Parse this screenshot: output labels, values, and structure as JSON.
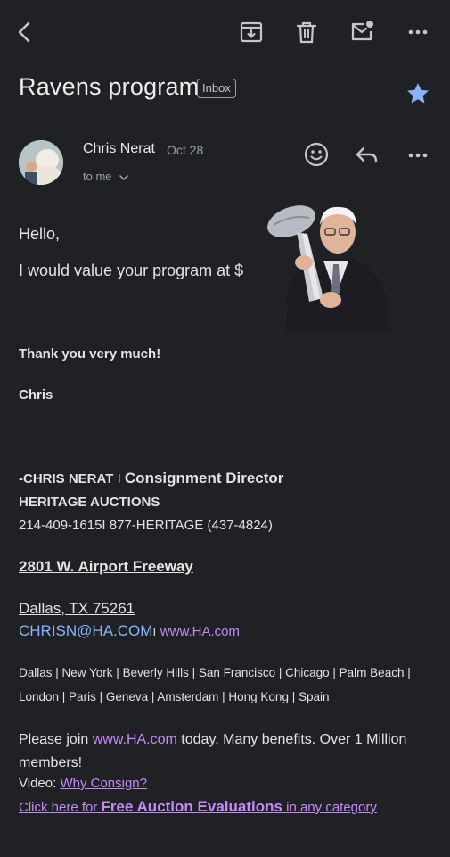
{
  "toolbar": {
    "back_icon": "back-arrow-icon",
    "archive_icon": "archive-icon",
    "delete_icon": "trash-icon",
    "mark_unread_icon": "mail-unread-icon",
    "more_icon": "more-icon"
  },
  "email": {
    "subject": "Ravens program",
    "label": "Inbox",
    "sender": "Chris Nerat",
    "date": "Oct 28",
    "recipient": "to me",
    "starred": true
  },
  "body": {
    "greeting": "Hello,",
    "line1": "I would value your program at $",
    "thanks": "Thank you very much!",
    "signoff": "Chris"
  },
  "signature": {
    "name_prefix": "-CHRIS NERAT",
    "divider": "I",
    "title": "Consignment Director",
    "company": "HERITAGE AUCTIONS",
    "phones": "214-409-1615I 877-HERITAGE (437-4824)",
    "street": "2801 W. Airport Freeway",
    "city": "Dallas, TX 75261",
    "email": "CHRISN@HA.COM",
    "email_sep": "I",
    "site": "www.HA.com",
    "locations_1": "Dallas | New York | Beverly Hills | San Francisco | Chicago | Palm Beach |",
    "locations_2": "London | Paris | Geneva | Amsterdam | Hong Kong | Spain",
    "join_prefix": "Please join",
    "join_link": " www.HA.com",
    "join_suffix": " today. Many benefits. Over 1 Million members!",
    "video_label": "Video: ",
    "video_link": "Why Consign? ",
    "click_here": "Click here for ",
    "free_eval": "Free Auction Evaluations",
    "any_category": " in any category"
  },
  "colors": {
    "background": "#202124",
    "link": "#8ab4f8",
    "visited_link": "#c58af9",
    "star": "#8ab4f8"
  }
}
